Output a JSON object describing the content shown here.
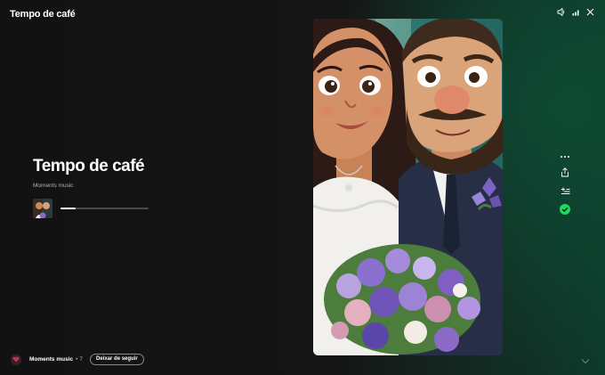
{
  "app": {
    "title": "Tempo de café"
  },
  "track": {
    "title": "Tempo de café",
    "artist": "Moments music",
    "progress": 0.17
  },
  "footer": {
    "artist": "Moments music",
    "separator": "•",
    "count": "7",
    "unfollow_label": "Deixar de seguir"
  },
  "icons": {
    "volume": "volume-icon",
    "connect": "signal-bars-icon",
    "close": "close-icon",
    "more": "more-icon",
    "share": "share-icon",
    "add_queue": "add-to-queue-icon",
    "saved": "check-circle-icon",
    "scroll_down": "chevron-down-icon"
  },
  "colors": {
    "accent": "#1ed760",
    "background": "#121212",
    "green_glow": "#0e4a34"
  }
}
